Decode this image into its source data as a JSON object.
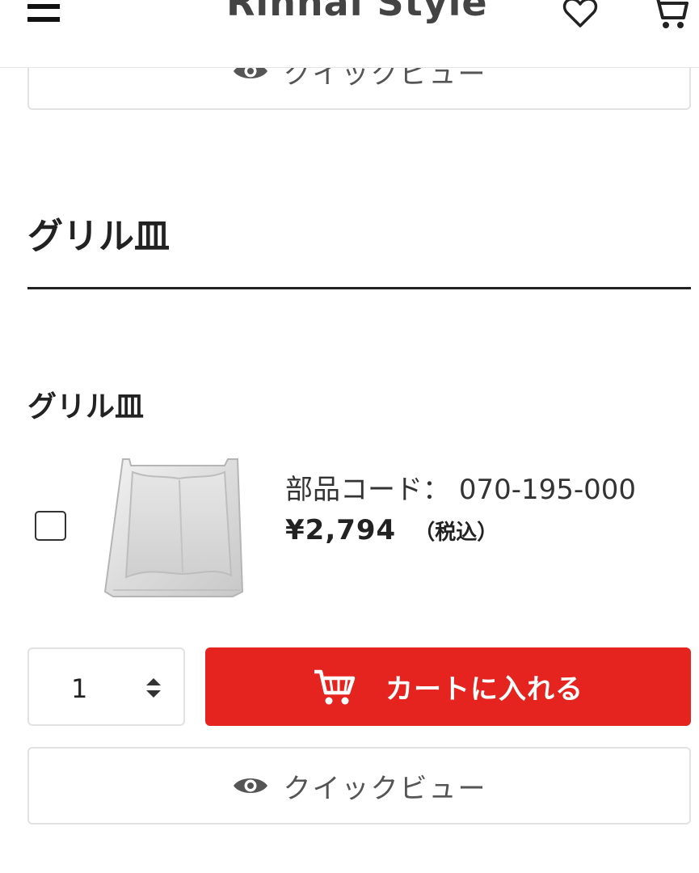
{
  "header": {
    "logo_text": "Rinnai Style",
    "menu_icon": "hamburger-menu-icon",
    "favorites_icon": "heart-icon",
    "cart_icon": "cart-icon"
  },
  "top_quickview": {
    "label": "クイックビュー",
    "icon": "eye-icon"
  },
  "section": {
    "title": "グリル皿"
  },
  "product": {
    "name": "グリル皿",
    "image_icon": "grill-pan-image",
    "part_code_label": "部品コード：",
    "part_code": "070-195-000",
    "price": "¥2,794",
    "tax_note": "（税込）",
    "checkbox_checked": false
  },
  "quantity": {
    "value": "1",
    "icon": "stepper-arrows-icon"
  },
  "add_to_cart": {
    "label": "カートに入れる",
    "icon": "cart-icon"
  },
  "bottom_quickview": {
    "label": "クイックビュー",
    "icon": "eye-icon"
  },
  "colors": {
    "accent_red": "#e52420",
    "border_gray": "#e2e2e2",
    "text_dark": "#222222"
  }
}
